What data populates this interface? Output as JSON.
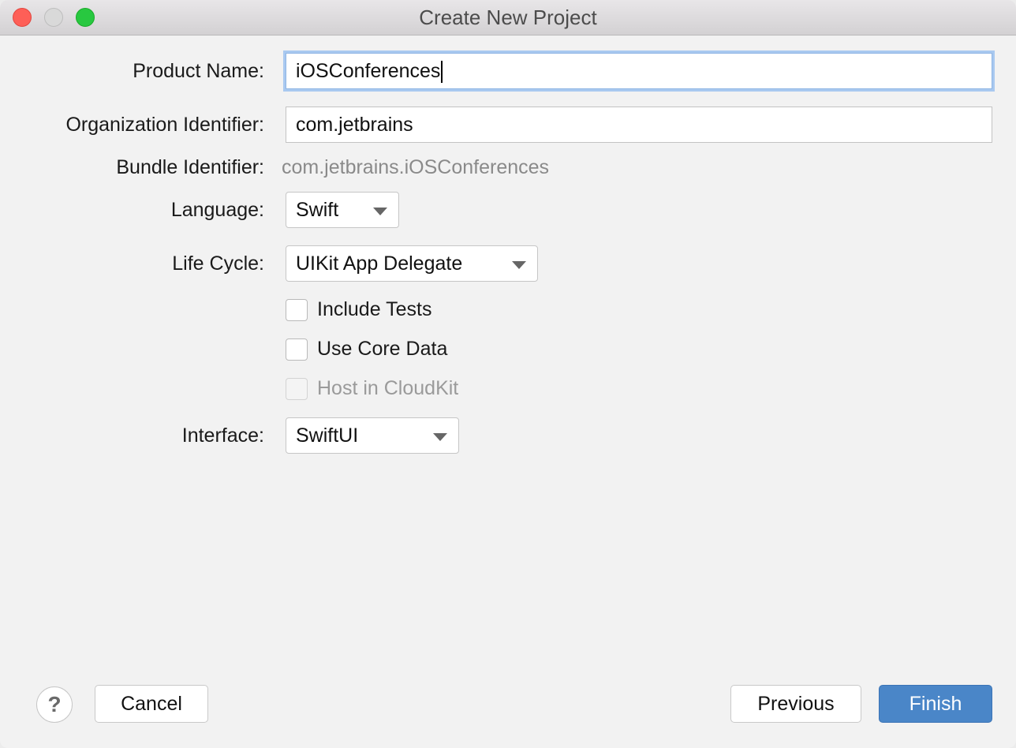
{
  "window": {
    "title": "Create New Project",
    "controls": {
      "close": "close-button",
      "minimize": "minimize-button",
      "zoom": "zoom-button"
    }
  },
  "form": {
    "product_name": {
      "label": "Product Name:",
      "value": "iOSConferences"
    },
    "organization_identifier": {
      "label": "Organization Identifier:",
      "value": "com.jetbrains"
    },
    "bundle_identifier": {
      "label": "Bundle Identifier:",
      "value": "com.jetbrains.iOSConferences"
    },
    "language": {
      "label": "Language:",
      "value": "Swift"
    },
    "life_cycle": {
      "label": "Life Cycle:",
      "value": "UIKit App Delegate"
    },
    "checkboxes": [
      {
        "label": "Include Tests",
        "checked": false,
        "enabled": true
      },
      {
        "label": "Use Core Data",
        "checked": false,
        "enabled": true
      },
      {
        "label": "Host in CloudKit",
        "checked": false,
        "enabled": false
      }
    ],
    "interface": {
      "label": "Interface:",
      "value": "SwiftUI"
    }
  },
  "footer": {
    "help": "?",
    "cancel": "Cancel",
    "previous": "Previous",
    "finish": "Finish"
  }
}
